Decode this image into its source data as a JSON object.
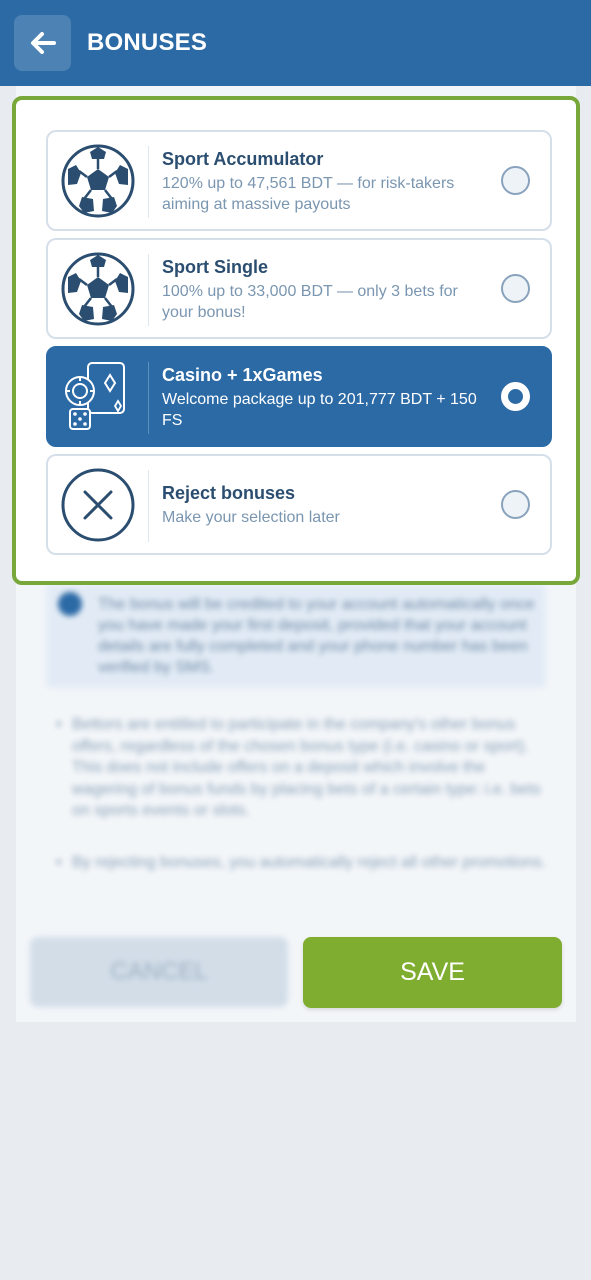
{
  "header": {
    "title": "BONUSES",
    "back_icon": "arrow-left-icon"
  },
  "bonus_options": [
    {
      "title": "Sport Accumulator",
      "description": "120% up to 47,561 BDT — for risk-takers aiming at massive payouts",
      "icon": "soccer-ball-icon",
      "selected": false
    },
    {
      "title": "Sport Single",
      "description": "100% up to 33,000 BDT — only 3 bets for your bonus!",
      "icon": "soccer-ball-icon",
      "selected": false
    },
    {
      "title": "Casino + 1xGames",
      "description": "Welcome package up to 201,777 BDT + 150 FS",
      "icon": "casino-cards-icon",
      "selected": true
    },
    {
      "title": "Reject bonuses",
      "description": "Make your selection later",
      "icon": "close-circle-icon",
      "selected": false
    }
  ],
  "info": {
    "text": "The bonus will be credited to your account automatically once you have made your first deposit, provided that your account details are fully completed and your phone number has been verified by SMS."
  },
  "notes": [
    "Bettors are entitled to participate in the company's other bonus offers, regardless of the chosen bonus type (i.e. casino or sport). This does not include offers on a deposit which involve the wagering of bonus funds by placing bets of a certain type: i.e. bets on sports events or slots.",
    "By rejecting bonuses, you automatically reject all other promotions."
  ],
  "buttons": {
    "cancel": "CANCEL",
    "save": "SAVE"
  },
  "colors": {
    "primary": "#2c6aa6",
    "accent_green": "#7fad2f",
    "title_text": "#2b4e70",
    "muted_text": "#7a96b0"
  }
}
